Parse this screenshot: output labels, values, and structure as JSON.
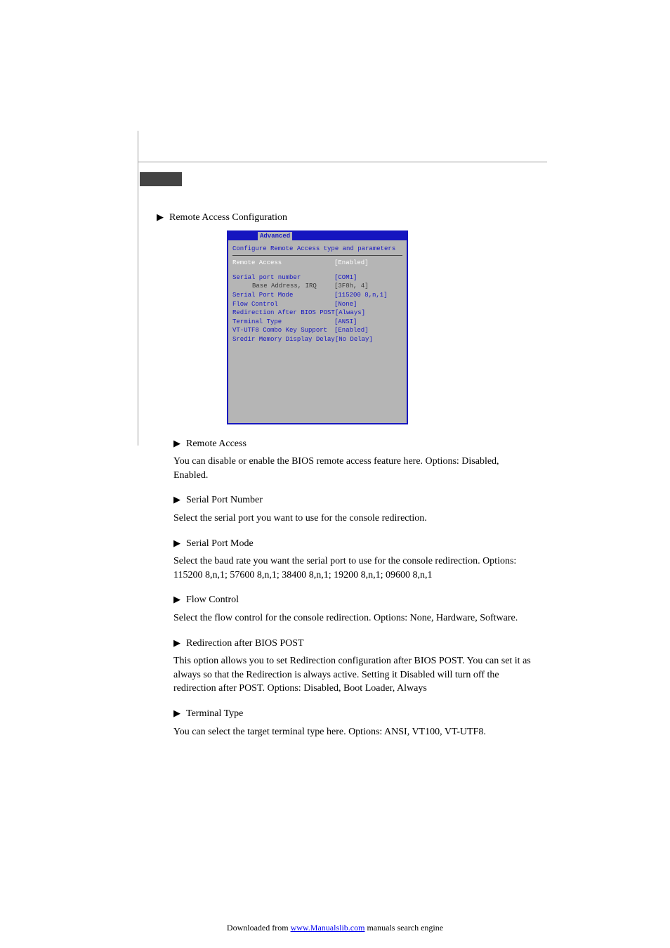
{
  "top_bullet": "Remote Access Configuration",
  "bios": {
    "tab": "Advanced",
    "heading": "Configure Remote Access type and parameters",
    "rows": [
      {
        "label": "Remote Access",
        "value": "[Enabled]",
        "style": "hilite"
      },
      {
        "label": "",
        "value": "",
        "style": "spacer"
      },
      {
        "label": "Serial port number",
        "value": "[COM1]",
        "style": "blue"
      },
      {
        "label": "Base Address, IRQ",
        "value": "[3F8h, 4]",
        "style": "gray",
        "sub": true
      },
      {
        "label": "Serial Port Mode",
        "value": "[115200 8,n,1]",
        "style": "blue"
      },
      {
        "label": "Flow Control",
        "value": "[None]",
        "style": "blue"
      },
      {
        "label": "Redirection After BIOS POST",
        "value": "[Always]",
        "style": "blue"
      },
      {
        "label": "Terminal Type",
        "value": "[ANSI]",
        "style": "blue"
      },
      {
        "label": "VT-UTF8 Combo Key Support",
        "value": "[Enabled]",
        "style": "blue"
      },
      {
        "label": "Sredir Memory Display Delay",
        "value": "[No Delay]",
        "style": "blue"
      }
    ]
  },
  "sections": [
    {
      "title": "Remote Access",
      "body": "You can disable or enable the BIOS remote access feature here. Options: Disabled, Enabled."
    },
    {
      "title": "Serial Port Number",
      "body": "Select the serial port you want to use for the console redirection."
    },
    {
      "title": "Serial Port Mode",
      "body": "Select the baud rate you want the serial port to use for the console redirection.  Options: 115200 8,n,1; 57600 8,n,1; 38400 8,n,1; 19200 8,n,1; 09600 8,n,1"
    },
    {
      "title": "Flow Control",
      "body": "Select the flow control for the console redirection.  Options: None, Hardware, Software."
    },
    {
      "title": "Redirection after BIOS POST",
      "body": "This option allows you to set Redirection configuration after BIOS POST. You can set it as always so that the Redirection is always active.  Setting it Disabled will turn off the redirection after POST.  Options: Disabled, Boot Loader, Always"
    },
    {
      "title": "Terminal Type",
      "body": "You can select the target terminal type here.  Options: ANSI, VT100, VT-UTF8."
    }
  ],
  "footer": {
    "text": "Downloaded from ",
    "link_text": "www.Manualslib.com",
    "trail": " manuals search engine"
  }
}
